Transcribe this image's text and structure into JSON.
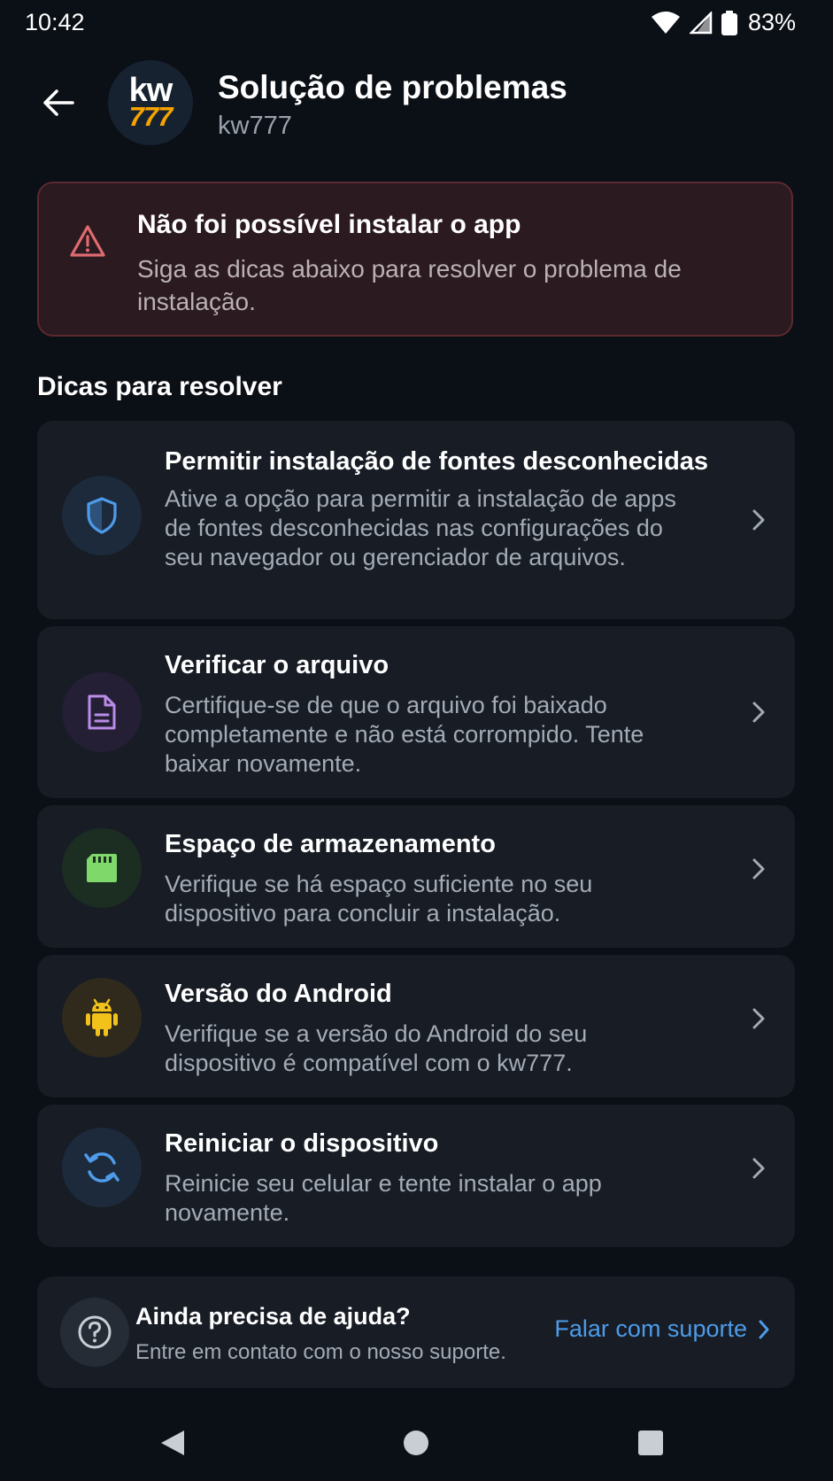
{
  "status_bar": {
    "time": "10:42",
    "battery": "83%"
  },
  "header": {
    "title": "Solução de problemas",
    "subtitle": "kw777",
    "logo_top": "kw",
    "logo_bottom": "777"
  },
  "error": {
    "title": "Não foi possível instalar o app",
    "description": "Siga as dicas abaixo para resolver o problema de instalação."
  },
  "section_title": "Dicas para resolver",
  "tips": [
    {
      "icon": "shield-icon",
      "title": "Permitir instalação de fontes desconhecidas",
      "description": "Ative a opção para permitir a instalação de apps de fontes desconhecidas nas configurações do seu navegador ou gerenciador de arquivos."
    },
    {
      "icon": "file-icon",
      "title": "Verificar o arquivo",
      "description": "Certifique-se de que o arquivo foi baixado completamente e não está corrompido. Tente baixar novamente."
    },
    {
      "icon": "sd-card-icon",
      "title": "Espaço de armazenamento",
      "description": "Verifique se há espaço suficiente no seu dispositivo para concluir a instalação."
    },
    {
      "icon": "android-icon",
      "title": "Versão do Android",
      "description": "Verifique se a versão do Android do seu dispositivo é compatível com o kw777."
    },
    {
      "icon": "refresh-icon",
      "title": "Reiniciar o dispositivo",
      "description": "Reinicie seu celular e tente instalar o app novamente."
    }
  ],
  "help": {
    "title": "Ainda precisa de ajuda?",
    "description": "Entre em contato com o nosso suporte.",
    "link": "Falar com suporte"
  },
  "colors": {
    "background": "#0b0f16",
    "card": "#171c25",
    "error_bg": "#2b1a1f",
    "error_icon": "#e06b70",
    "link": "#4d9be9",
    "shield": "#4d9be9",
    "file": "#b98ce8",
    "sd_card": "#7fd86a",
    "android": "#f2c21b",
    "refresh": "#4d9be9",
    "logo_accent": "#f6a300"
  }
}
